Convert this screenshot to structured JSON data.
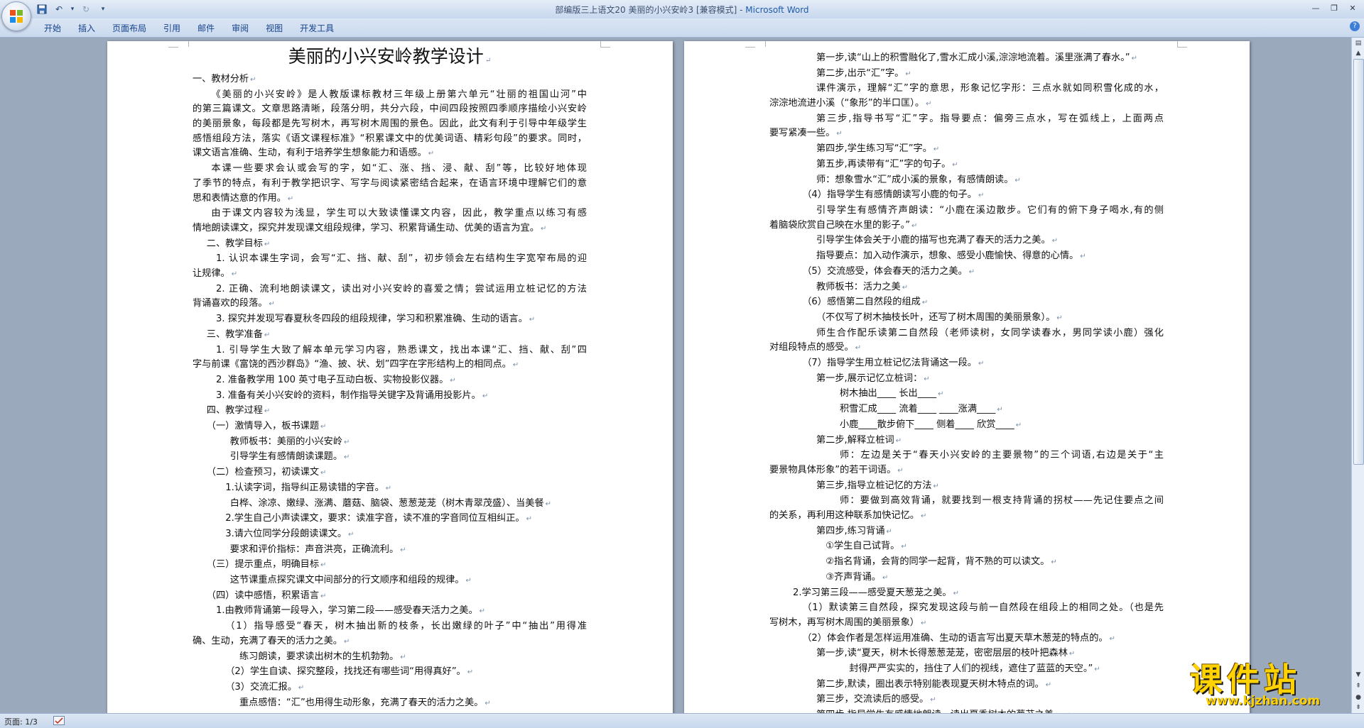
{
  "window": {
    "title": "部编版三上语文20 美丽的小兴安岭3 [兼容模式] - ",
    "app_name": "Microsoft Word"
  },
  "ribbon": {
    "tabs": [
      "开始",
      "插入",
      "页面布局",
      "引用",
      "邮件",
      "审阅",
      "视图",
      "开发工具"
    ]
  },
  "status": {
    "page_count": "页面: 1/3"
  },
  "watermark": {
    "text": "课件站",
    "url": "www.kjzhan.com"
  },
  "colors": {
    "accent": "#1e5aa8",
    "tab_text": "#15428b",
    "watermark": "#ffd200"
  },
  "page1": {
    "title": "美丽的小兴安岭教学设计",
    "lines": [
      {
        "t": "一、教材分析",
        "i": 0
      },
      {
        "t": "《美丽的小兴安岭》是人教版课标教材三年级上册第六单元“壮丽的祖国山河”中",
        "i": 2,
        "j": true
      },
      {
        "t": "的第三篇课文。文章思路清晰，段落分明，共分六段，中间四段按照四季顺序描绘小兴安岭",
        "i": 0,
        "j": true
      },
      {
        "t": "的美丽景象，每段都是先写树木，再写树木周围的景色。因此，此文有利于引导中年级学生",
        "i": 0,
        "j": true
      },
      {
        "t": "感悟组段方法，落实《语文课程标准》“积累课文中的优美词语、精彩句段”的要求。同时，",
        "i": 0,
        "j": true
      },
      {
        "t": "课文语言准确、生动，有利于培养学生想象能力和语感。",
        "i": 0
      },
      {
        "t": "本课一些要求会认或会写的字，如“汇、涨、挡、浸、献、刮”等，比较好地体现",
        "i": 2,
        "j": true
      },
      {
        "t": "了季节的特点，有利于教学把识字、写字与阅读紧密结合起来，在语言环境中理解它们的意",
        "i": 0,
        "j": true
      },
      {
        "t": "思和表情达意的作用。",
        "i": 0
      },
      {
        "t": "由于课文内容较为浅显，学生可以大致读懂课文内容，因此，教学重点以练习有感",
        "i": 2,
        "j": true
      },
      {
        "t": "情地朗读课文，探究并发现课文组段规律，学习、积累背诵生动、优美的语言为宜。",
        "i": 0
      },
      {
        "t": "二、教学目标",
        "i": 1.5
      },
      {
        "t": "1. 认识本课生字词，会写“汇、挡、献、刮”，初步领会左右结构生字宽窄布局的迎",
        "i": 2.5,
        "j": true
      },
      {
        "t": "让规律。",
        "i": 0
      },
      {
        "t": "2. 正确、流利地朗读课文，读出对小兴安岭的喜爱之情；尝试运用立桩记忆的方法",
        "i": 2.5,
        "j": true
      },
      {
        "t": "背诵喜欢的段落。",
        "i": 0
      },
      {
        "t": "3. 探究并发现写春夏秋冬四段的组段规律，学习和积累准确、生动的语言。",
        "i": 2.5
      },
      {
        "t": "三、教学准备",
        "i": 1.5
      },
      {
        "t": "1. 引导学生大致了解本单元学习内容，熟悉课文，找出本课“汇、挡、献、刮”四",
        "i": 2.5,
        "j": true
      },
      {
        "t": "字与前课《富饶的西沙群岛》“渔、披、状、划”四字在字形结构上的相同点。",
        "i": 0
      },
      {
        "t": "2. 准备教学用 100 英寸电子互动白板、实物投影仪器。",
        "i": 2.5
      },
      {
        "t": "3. 准备有关小兴安岭的资料，制作指导关键字及背诵用投影片。",
        "i": 2.5
      },
      {
        "t": "四、教学过程",
        "i": 1.5
      },
      {
        "t": "（一）激情导入，板书课题",
        "i": 1.5
      },
      {
        "t": "教师板书：美丽的小兴安岭",
        "i": 4
      },
      {
        "t": "引导学生有感情朗读课题。",
        "i": 4
      },
      {
        "t": "（二）检查预习，初读课文",
        "i": 1.5
      },
      {
        "t": "1.认读字词，指导纠正易读错的字音。",
        "i": 3.5
      },
      {
        "t": "白桦、涂凉、嫩绿、涨满、蘑菇、脑袋、葱葱茏茏（树木青翠茂盛）、当美餐",
        "i": 4
      },
      {
        "t": "2.学生自己小声读课文，要求：读准字音，读不准的字音同位互相纠正。",
        "i": 3.5
      },
      {
        "t": "3.请六位同学分段朗读课文。",
        "i": 3.5
      },
      {
        "t": "要求和评价指标：声音洪亮，正确流利。",
        "i": 4
      },
      {
        "t": "（三）提示重点，明确目标",
        "i": 1.5
      },
      {
        "t": "这节课重点探究课文中间部分的行文顺序和组段的规律。",
        "i": 4
      },
      {
        "t": "（四）读中感悟，积累语言",
        "i": 1.5
      },
      {
        "t": "1.由教师背诵第一段导入，学习第二段——感受春天活力之美。",
        "i": 2.5
      },
      {
        "t": "（1）指导感受“春天，树木抽出新的枝条，长出嫩绿的叶子”中“抽出”用得准",
        "i": 3.5,
        "j": true
      },
      {
        "t": "确、生动，充满了春天的活力之美。",
        "i": 0
      },
      {
        "t": "练习朗读，要求读出树木的生机勃勃。",
        "i": 5
      },
      {
        "t": "（2）学生自读、探究整段，找找还有哪些词“用得真好”。",
        "i": 3.5
      },
      {
        "t": "（3）交流汇报。",
        "i": 3.5
      },
      {
        "t": "重点感悟：“汇”也用得生动形象，充满了春天的活力之美。",
        "i": 5
      }
    ]
  },
  "page2": {
    "lines": [
      {
        "t": "第一步,读“山上的积雪融化了,雪水汇成小溪,淙淙地流着。溪里涨满了春水。”",
        "i": 5
      },
      {
        "t": "第二步,出示“汇”字。",
        "i": 5
      },
      {
        "t": "课件演示，理解“汇”字的意思，形象记忆字形：三点水就如同积雪化成的水，",
        "i": 5,
        "j": true
      },
      {
        "t": "淙淙地流进小溪（“象形”的半口匡）。",
        "i": 0
      },
      {
        "t": "第三步,指导书写“汇”字。指导要点：偏旁三点水，写在弧线上，上面两点",
        "i": 5,
        "j": true
      },
      {
        "t": "要写紧凑一些。",
        "i": 0
      },
      {
        "t": "第四步,学生练习写“汇”字。",
        "i": 5
      },
      {
        "t": "第五步,再读带有“汇”字的句子。",
        "i": 5
      },
      {
        "t": "师：想象雪水“汇”成小溪的景象，有感情朗读。",
        "i": 5
      },
      {
        "t": "（4）指导学生有感情朗读写小鹿的句子。",
        "i": 3.5
      },
      {
        "t": "引导学生有感情齐声朗读：“小鹿在溪边散步。它们有的俯下身子喝水,有的侧",
        "i": 5,
        "j": true
      },
      {
        "t": "着脑袋欣赏自己映在水里的影子。”",
        "i": 0
      },
      {
        "t": "引导学生体会关于小鹿的描写也充满了春天的活力之美。",
        "i": 5
      },
      {
        "t": "指导要点：加入动作演示，想象、感受小鹿愉快、得意的心情。",
        "i": 5
      },
      {
        "t": "（5）交流感受，体会春天的活力之美。",
        "i": 3.5
      },
      {
        "t": "教师板书：活力之美",
        "i": 5
      },
      {
        "t": "（6）感悟第二自然段的组成",
        "i": 3.5
      },
      {
        "t": "（不仅写了树木抽枝长叶，还写了树木周围的美丽景象）。",
        "i": 5
      },
      {
        "t": "师生合作配乐读第二自然段（老师读树，女同学读春水，男同学读小鹿）强化",
        "i": 5,
        "j": true
      },
      {
        "t": "对组段特点的感受。",
        "i": 0
      },
      {
        "t": "（7）指导学生用立桩记忆法背诵这一段。",
        "i": 3.5
      },
      {
        "t": "第一步,展示记忆立桩词：",
        "i": 5
      },
      {
        "t": "树木抽出____ 长出____",
        "i": 7.5
      },
      {
        "t": "积雪汇成____ 流着____ ____涨满____",
        "i": 7.5
      },
      {
        "t": "小鹿____散步俯下____ 侧着____ 欣赏____",
        "i": 7.5
      },
      {
        "t": "第二步,解释立桩词",
        "i": 5
      },
      {
        "t": "师：左边是关于“春天小兴安岭的主要景物”的三个词语,右边是关于“主",
        "i": 7.5,
        "j": true
      },
      {
        "t": "要景物具体形象”的若干词语。",
        "i": 0
      },
      {
        "t": "第三步,指导立桩记忆的方法",
        "i": 5
      },
      {
        "t": "师：要做到高效背诵，就要找到一根支持背诵的拐杖——先记住要点之间",
        "i": 7.5,
        "j": true
      },
      {
        "t": "的关系，再利用这种联系加快记忆。",
        "i": 0
      },
      {
        "t": "第四步,练习背诵",
        "i": 5
      },
      {
        "t": "①学生自己试背。",
        "i": 6
      },
      {
        "t": "②指名背诵，会背的同学一起背，背不熟的可以读文。",
        "i": 6
      },
      {
        "t": "③齐声背诵。",
        "i": 6
      },
      {
        "t": "2.学习第三段——感受夏天葱茏之美。",
        "i": 2.5
      },
      {
        "t": "（1）默读第三自然段，探究发现这段与前一自然段在组段上的相同之处。（也是先",
        "i": 3.5,
        "j": true
      },
      {
        "t": "写树木，再写树木周围的美丽景象）",
        "i": 0
      },
      {
        "t": "（2）体会作者是怎样运用准确、生动的语言写出夏天草木葱茏的特点的。",
        "i": 3.5
      },
      {
        "t": "第一步,读“夏天，树木长得葱葱茏茏，密密层层的枝叶把森林",
        "i": 5
      },
      {
        "t": "封得严严实实的，挡住了人们的视线，遮住了蓝蓝的天空。”",
        "i": 8.5
      },
      {
        "t": "第二步,默读，圈出表示特别能表现夏天树木特点的词。",
        "i": 5
      },
      {
        "t": "第三步，交流读后的感受。",
        "i": 5
      },
      {
        "t": "第四步,指导学生有感情地朗读，读出夏季树木的葱茏之美。",
        "i": 5
      }
    ]
  }
}
